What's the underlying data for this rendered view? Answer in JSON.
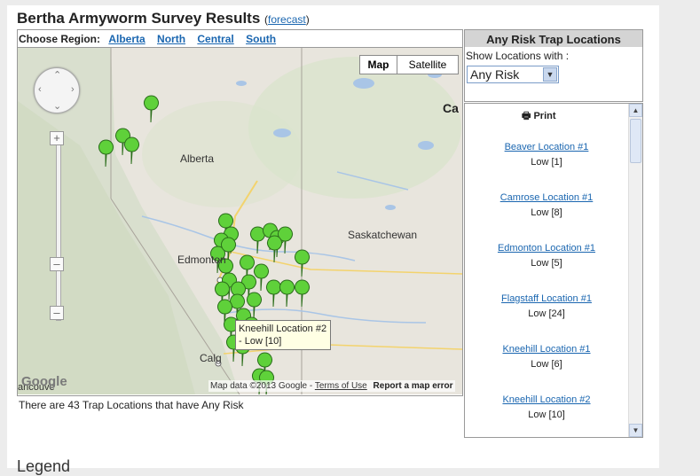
{
  "header": {
    "title": "Bertha Armyworm Survey Results",
    "forecast_link": "forecast"
  },
  "regions": {
    "label": "Choose Region:",
    "items": [
      "Alberta",
      "North",
      "Central",
      "South"
    ]
  },
  "map": {
    "type_buttons": [
      "Map",
      "Satellite"
    ],
    "selected_type": "Map",
    "labels": {
      "alberta": "Alberta",
      "saskatchewan": "Saskatchewan",
      "edmonton": "Edmonton",
      "calgary": "Calg",
      "vancouver": "ancouve",
      "canada": "Ca"
    },
    "tooltip": "Kneehill Location #2 - Low [10]",
    "attribution": "Map data ©2013 Google -",
    "terms_link": "Terms of Use",
    "report_link": "Report a map error",
    "google_logo": "Google",
    "marker_color": "#5fd13a"
  },
  "summary": "There are 43 Trap Locations that have Any Risk",
  "panel": {
    "title": "Any Risk Trap Locations",
    "show_label": "Show Locations with :",
    "selected_option": "Any Risk"
  },
  "locations_list": {
    "print_label": "Print",
    "items": [
      {
        "name": "Beaver Location #1",
        "risk": "Low [1]"
      },
      {
        "name": "Camrose Location #1",
        "risk": "Low [8]"
      },
      {
        "name": "Edmonton Location #1",
        "risk": "Low [5]"
      },
      {
        "name": "Flagstaff Location #1",
        "risk": "Low [24]"
      },
      {
        "name": "Kneehill Location #1",
        "risk": "Low [6]"
      },
      {
        "name": "Kneehill Location #2",
        "risk": "Low [10]"
      }
    ]
  },
  "legend_title": "Legend"
}
